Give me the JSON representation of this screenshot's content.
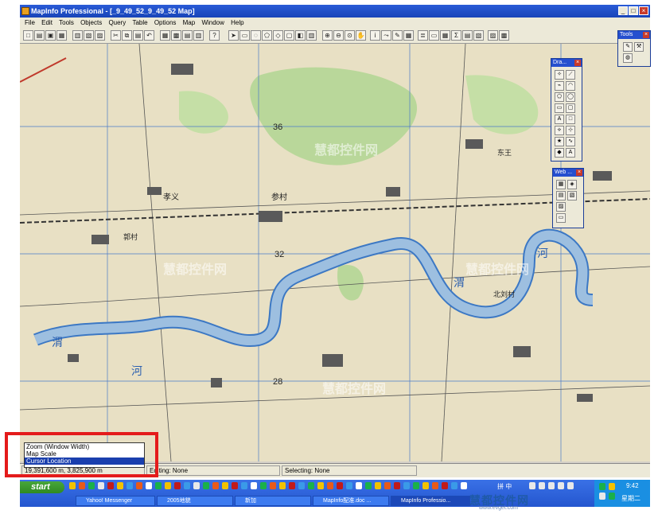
{
  "window": {
    "title": "MapInfo Professional - [_9_49_52_9_49_52 Map]",
    "buttons": {
      "minimize": "_",
      "maximize": "□",
      "close": "×"
    }
  },
  "menu": [
    "File",
    "Edit",
    "Tools",
    "Objects",
    "Query",
    "Table",
    "Options",
    "Map",
    "Window",
    "Help"
  ],
  "palettes": {
    "tools": {
      "title": "Tools"
    },
    "drawing": {
      "title": "Dra..."
    },
    "web": {
      "title": "Web ..."
    }
  },
  "zoom_dropdown": {
    "items": [
      "Zoom (Window Width)",
      "Map Scale",
      "Cursor Location"
    ],
    "selected": "Cursor Location"
  },
  "status": {
    "coords": "19,391,600 m, 3,825,900 m",
    "editing": "Editing: None",
    "selecting": "Selecting: None"
  },
  "taskbar": {
    "start": "start",
    "tasks": [
      "Yahoo! Messenger",
      "2005地貌",
      "新加",
      "MapInfo配准.doc ...",
      "MapInfo Professio..."
    ],
    "ime": "拼 中",
    "time": "9:42",
    "day": "星期二"
  },
  "map_labels": {
    "grid_numbers": [
      "36",
      "32",
      "28"
    ],
    "river_chars": [
      "河",
      "渭",
      "河",
      "渭",
      "河"
    ],
    "villages": [
      "孝义",
      "参村",
      "北刘村",
      "东王",
      "郭村"
    ]
  },
  "watermark": {
    "text": "慧都控件网",
    "url": "www.evget.com"
  },
  "colors": {
    "title_bar": "#1844b8",
    "map_bg": "#e8e0c4",
    "river": "#9dbfe0",
    "river_edge": "#3c78c4",
    "green_area": "#b9d79a",
    "highlight_box": "#e41b1b",
    "taskbar": "#2456cf",
    "start_button": "#3a9a2e"
  }
}
